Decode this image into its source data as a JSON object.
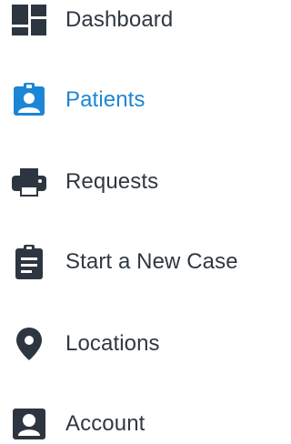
{
  "nav": {
    "items": [
      {
        "label": "Dashboard",
        "icon": "dashboard-icon",
        "active": false
      },
      {
        "label": "Patients",
        "icon": "patient-badge-icon",
        "active": true
      },
      {
        "label": "Requests",
        "icon": "printer-icon",
        "active": false
      },
      {
        "label": "Start a New Case",
        "icon": "clipboard-icon",
        "active": false
      },
      {
        "label": "Locations",
        "icon": "map-pin-icon",
        "active": false
      },
      {
        "label": "Account",
        "icon": "account-icon",
        "active": false
      }
    ]
  },
  "colors": {
    "text": "#303841",
    "icon": "#2d3640",
    "active": "#1b86d6"
  }
}
